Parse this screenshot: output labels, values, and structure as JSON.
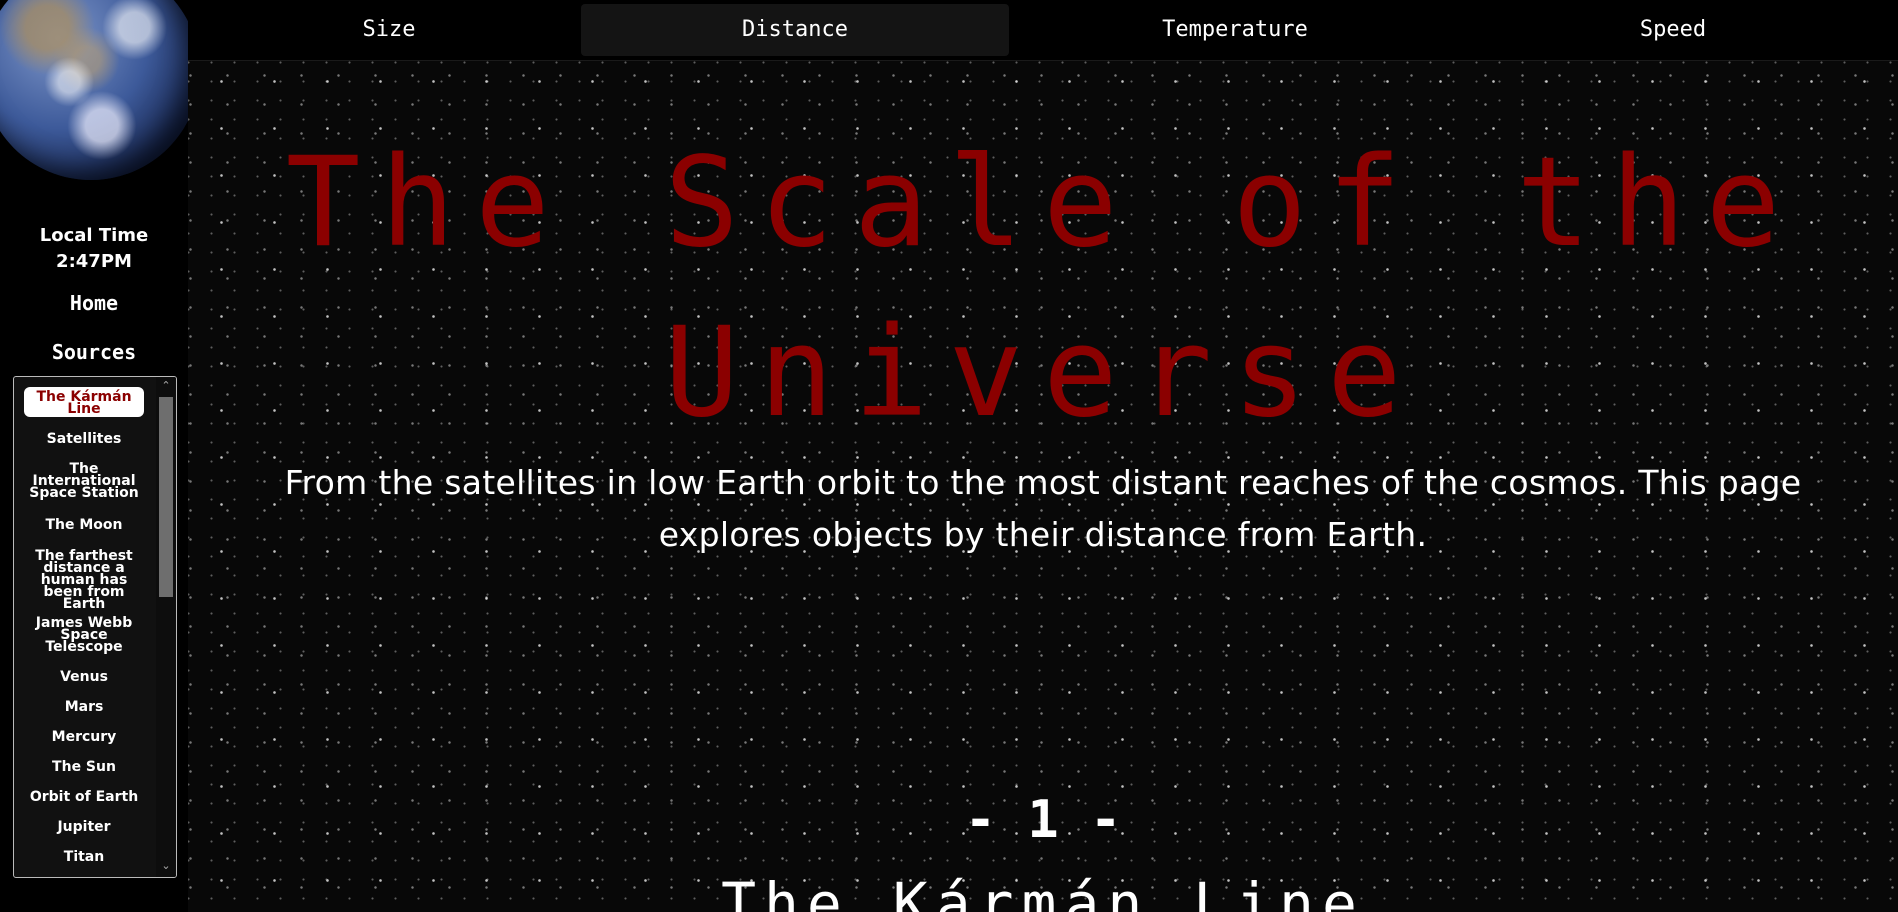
{
  "sidebar": {
    "local_time_label": "Local Time",
    "local_time_value": "2:47PM",
    "home_label": "Home",
    "sources_label": "Sources",
    "items": [
      {
        "label": "The Kármán Line",
        "active": true
      },
      {
        "label": "Satellites"
      },
      {
        "label": "The International Space Station"
      },
      {
        "label": "The Moon"
      },
      {
        "label": "The farthest distance a human has been from Earth"
      },
      {
        "label": "James Webb Space Telescope"
      },
      {
        "label": "Venus"
      },
      {
        "label": "Mars"
      },
      {
        "label": "Mercury"
      },
      {
        "label": "The Sun"
      },
      {
        "label": "Orbit of Earth"
      },
      {
        "label": "Jupiter"
      },
      {
        "label": "Titan"
      }
    ]
  },
  "nav": {
    "tabs": [
      {
        "label": "Size"
      },
      {
        "label": "Distance",
        "active": true
      },
      {
        "label": "Temperature"
      },
      {
        "label": "Speed"
      }
    ]
  },
  "main": {
    "title_line1": "The Scale of the",
    "title_line2": "Universe",
    "subtitle": "From the satellites in low Earth orbit to the most distant reaches of the cosmos. This page explores objects by their distance from Earth.",
    "section_number": "- 1 -",
    "section_title": "The Kármán Line"
  },
  "colors": {
    "title": "#8b0000",
    "active_item_text": "#8b0000",
    "background": "#000000"
  },
  "icons": {
    "earth_image": "earth-globe",
    "scroll_up": "chevron-up-icon",
    "scroll_down": "chevron-down-icon"
  }
}
